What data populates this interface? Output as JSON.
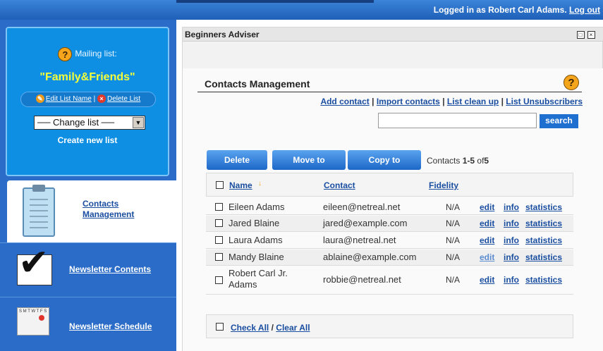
{
  "header": {
    "login_text": "Logged in as Robert Carl Adams.",
    "logout_label": "Log out"
  },
  "sidebar": {
    "mailing_label": "Mailing list:",
    "list_name": "\"Family&Friends\"",
    "edit_list_label": "Edit List Name",
    "separator": "|",
    "delete_list_label": "Delete List",
    "change_list_value": "── Change list ──",
    "create_list_label": "Create new list",
    "nav": [
      {
        "label": "Contacts Management",
        "icon": "clipboard-icon",
        "active": true
      },
      {
        "label": "Newsletter Contents",
        "icon": "checkmark-icon",
        "active": false
      },
      {
        "label": "Newsletter Schedule",
        "icon": "calendar-icon",
        "active": false
      }
    ],
    "calendar_days": "S M T W T F S"
  },
  "panel": {
    "title": "Beginners Adviser",
    "section_title": "Contacts Management",
    "links": [
      "Add contact",
      "Import contacts",
      "List clean up",
      "List Unsubscribers"
    ],
    "link_sep": "|",
    "search_value": "",
    "search_label": "search",
    "buttons": {
      "delete": "Delete",
      "move": "Move to",
      "copy": "Copy to"
    },
    "count_prefix": "Contacts",
    "count_range": "1-5",
    "count_of": "of",
    "count_total": "5"
  },
  "table": {
    "columns": [
      "Name",
      "Contact",
      "Fidelity"
    ],
    "rows": [
      {
        "name": "Eileen Adams",
        "contact": "eileen@netreal.net",
        "fidelity": "N/A"
      },
      {
        "name": "Jared Blaine",
        "contact": "jared@example.com",
        "fidelity": "N/A"
      },
      {
        "name": "Laura Adams",
        "contact": "laura@netreal.net",
        "fidelity": "N/A"
      },
      {
        "name": "Mandy Blaine",
        "contact": "ablaine@example.com",
        "fidelity": "N/A"
      },
      {
        "name": "Robert Carl Jr. Adams",
        "contact": "robbie@netreal.net",
        "fidelity": "N/A"
      }
    ],
    "actions": {
      "edit": "edit",
      "info": "info",
      "statistics": "statistics"
    },
    "check_all": "Check All",
    "foot_sep": "/",
    "clear_all": "Clear All"
  },
  "colors": {
    "accent": "#2a6cc8",
    "link": "#1a4ea0",
    "list_name": "#f4ff3a"
  }
}
